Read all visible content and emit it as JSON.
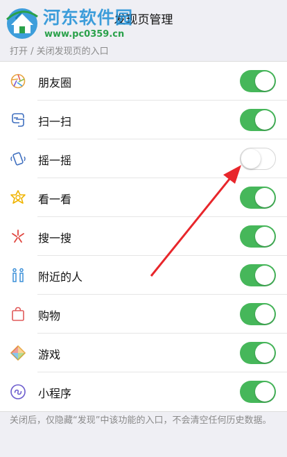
{
  "header": {
    "title": "发现页管理",
    "back_icon": "chevron-left-icon"
  },
  "watermark": {
    "name": "河东软件园",
    "url": "www.pc0359.cn"
  },
  "section_label": "打开 / 关闭发现页的入口",
  "items": [
    {
      "label": "朋友圈",
      "icon": "moments-aperture-icon",
      "enabled": true
    },
    {
      "label": "扫一扫",
      "icon": "scan-icon",
      "enabled": true
    },
    {
      "label": "摇一摇",
      "icon": "shake-phone-icon",
      "enabled": false
    },
    {
      "label": "看一看",
      "icon": "top-stories-icon",
      "enabled": true
    },
    {
      "label": "搜一搜",
      "icon": "search-sparkle-icon",
      "enabled": true
    },
    {
      "label": "附近的人",
      "icon": "people-nearby-icon",
      "enabled": true
    },
    {
      "label": "购物",
      "icon": "shopping-bag-icon",
      "enabled": true
    },
    {
      "label": "游戏",
      "icon": "game-icon",
      "enabled": true
    },
    {
      "label": "小程序",
      "icon": "mini-program-icon",
      "enabled": true
    }
  ],
  "footer_note": "关闭后，仅隐藏“发现”中该功能的入口，不会清空任何历史数据。",
  "colors": {
    "toggle_on": "#46b75a",
    "annotation_arrow": "#e8262b"
  }
}
